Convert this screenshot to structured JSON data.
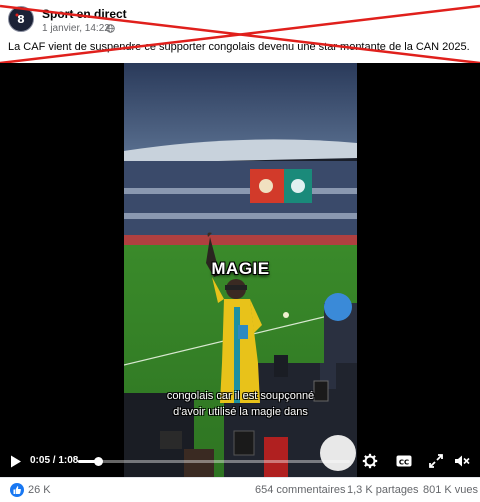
{
  "post": {
    "page_name": "Sport en direct",
    "date": "1 janvier, 14:22",
    "privacy_icon": "globe-icon",
    "caption": "La CAF vient de suspendre ce supporter congolais devenu une star montante de la CAN 2025."
  },
  "video": {
    "overlay_word": "MAGIE",
    "subtitle_line1": "congolais car il est soupçonné",
    "subtitle_line2": "d'avoir utilisé la magie dans",
    "time": "0:05 / 1:08",
    "progress": 0.074,
    "icons": [
      "play-icon",
      "gear-icon",
      "cc-icon",
      "expand-icon",
      "volume-icon"
    ]
  },
  "stats": {
    "likes": "26 K",
    "comments": "654 commentaires",
    "shares": "1,3 K partages",
    "views": "801 K vues"
  },
  "colors": {
    "cross": "#e0201c",
    "like_blue": "#1877f2",
    "pitch": "#3f8f2c",
    "jersey": "#e8c21a"
  }
}
